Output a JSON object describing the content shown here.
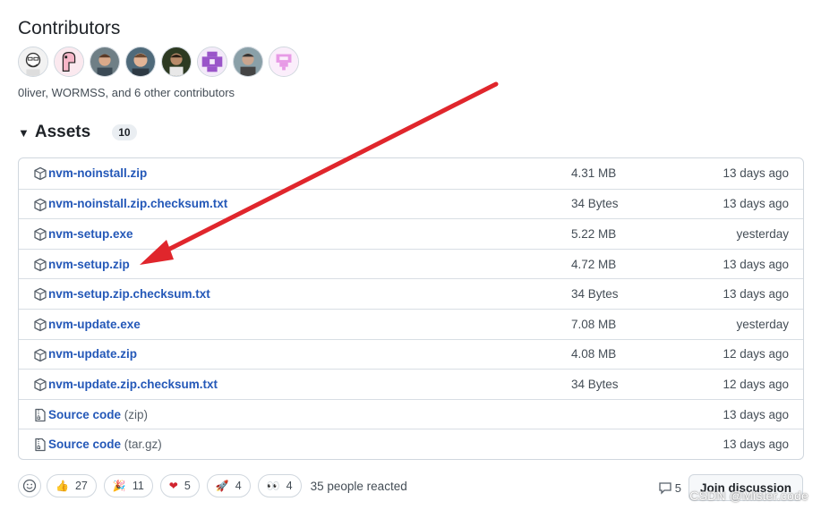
{
  "contributors": {
    "title": "Contributors",
    "summary": "0liver, WORMSS, and 6 other contributors",
    "avatars": [
      "avatar-1",
      "avatar-2",
      "avatar-3",
      "avatar-4",
      "avatar-5",
      "avatar-6",
      "avatar-7",
      "avatar-8"
    ]
  },
  "assets": {
    "title": "Assets",
    "count": "10",
    "items": [
      {
        "name": "nvm-noinstall.zip",
        "size": "4.31 MB",
        "date": "13 days ago",
        "icon": "package-icon"
      },
      {
        "name": "nvm-noinstall.zip.checksum.txt",
        "size": "34 Bytes",
        "date": "13 days ago",
        "icon": "package-icon"
      },
      {
        "name": "nvm-setup.exe",
        "size": "5.22 MB",
        "date": "yesterday",
        "icon": "package-icon"
      },
      {
        "name": "nvm-setup.zip",
        "size": "4.72 MB",
        "date": "13 days ago",
        "icon": "package-icon"
      },
      {
        "name": "nvm-setup.zip.checksum.txt",
        "size": "34 Bytes",
        "date": "13 days ago",
        "icon": "package-icon"
      },
      {
        "name": "nvm-update.exe",
        "size": "7.08 MB",
        "date": "yesterday",
        "icon": "package-icon"
      },
      {
        "name": "nvm-update.zip",
        "size": "4.08 MB",
        "date": "12 days ago",
        "icon": "package-icon"
      },
      {
        "name": "nvm-update.zip.checksum.txt",
        "size": "34 Bytes",
        "date": "12 days ago",
        "icon": "package-icon"
      }
    ],
    "source": [
      {
        "name": "Source code",
        "ext": "(zip)",
        "date": "13 days ago",
        "icon": "file-zip-icon"
      },
      {
        "name": "Source code",
        "ext": "(tar.gz)",
        "date": "13 days ago",
        "icon": "file-zip-icon"
      }
    ]
  },
  "reactions": {
    "items": [
      {
        "emoji": "👍",
        "count": "27",
        "icon": "thumbs-up-icon"
      },
      {
        "emoji": "🎉",
        "count": "11",
        "icon": "party-icon"
      },
      {
        "emoji": "❤",
        "count": "5",
        "icon": "heart-icon"
      },
      {
        "emoji": "🚀",
        "count": "4",
        "icon": "rocket-icon"
      },
      {
        "emoji": "👀",
        "count": "4",
        "icon": "eyes-icon"
      }
    ],
    "summary": "35 people reacted"
  },
  "discussion": {
    "comment_count": "5",
    "join_label": "Join discussion"
  },
  "watermark": "CSDN @Mister.code",
  "colors": {
    "link": "#2458b8",
    "arrow": "#e0262c",
    "border": "#d0d7de"
  }
}
